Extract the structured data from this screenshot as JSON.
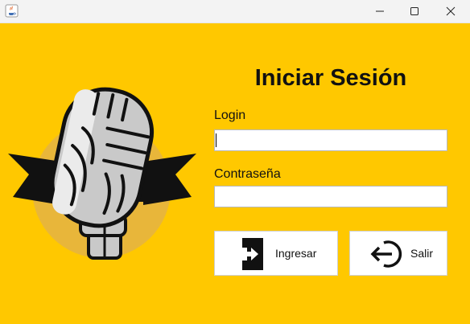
{
  "window": {
    "app_icon": "java-cup-icon",
    "controls": {
      "minimize": "minimize-icon",
      "maximize": "maximize-icon",
      "close": "close-icon"
    }
  },
  "colors": {
    "background": "#ffc800",
    "illustration_circle": "#e8b63a",
    "banner": "#111111",
    "mic_body": "#c9c9c9"
  },
  "illustration": {
    "name": "microphone-illustration"
  },
  "form": {
    "title": "Iniciar Sesión",
    "login_label": "Login",
    "login_value": "",
    "password_label": "Contraseña",
    "password_value": ""
  },
  "buttons": {
    "ingresar_label": "Ingresar",
    "ingresar_icon": "login-arrow-icon",
    "salir_label": "Salir",
    "salir_icon": "exit-arrow-icon"
  }
}
